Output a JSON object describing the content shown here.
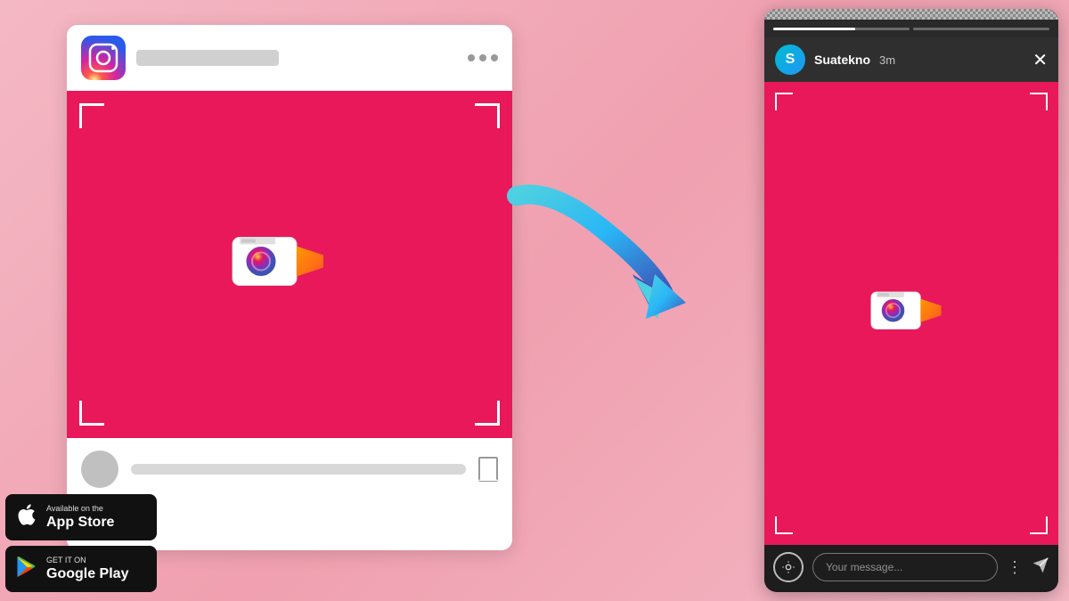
{
  "background": {
    "color": "#f0a0b0"
  },
  "left_phone": {
    "header": {
      "username_placeholder": "",
      "dots": [
        "●",
        "●",
        "●"
      ]
    },
    "post": {
      "bg_color": "#e8185a"
    },
    "footer": {
      "message_placeholder": ""
    }
  },
  "right_phone": {
    "header": {
      "username": "Suatekno",
      "time": "3m",
      "close": "✕"
    },
    "story": {
      "bg_color": "#e8185a"
    },
    "footer": {
      "message_placeholder": "Your message...",
      "send_icon": "➤",
      "dots_icon": "⋮",
      "cam_icon": "⊙"
    }
  },
  "arrow": {
    "direction": "right-down curve"
  },
  "badges": {
    "appstore": {
      "small_text": "Available on the",
      "large_text": "App Store"
    },
    "googleplay": {
      "small_text": "GET IT ON",
      "large_text": "Google Play"
    }
  }
}
